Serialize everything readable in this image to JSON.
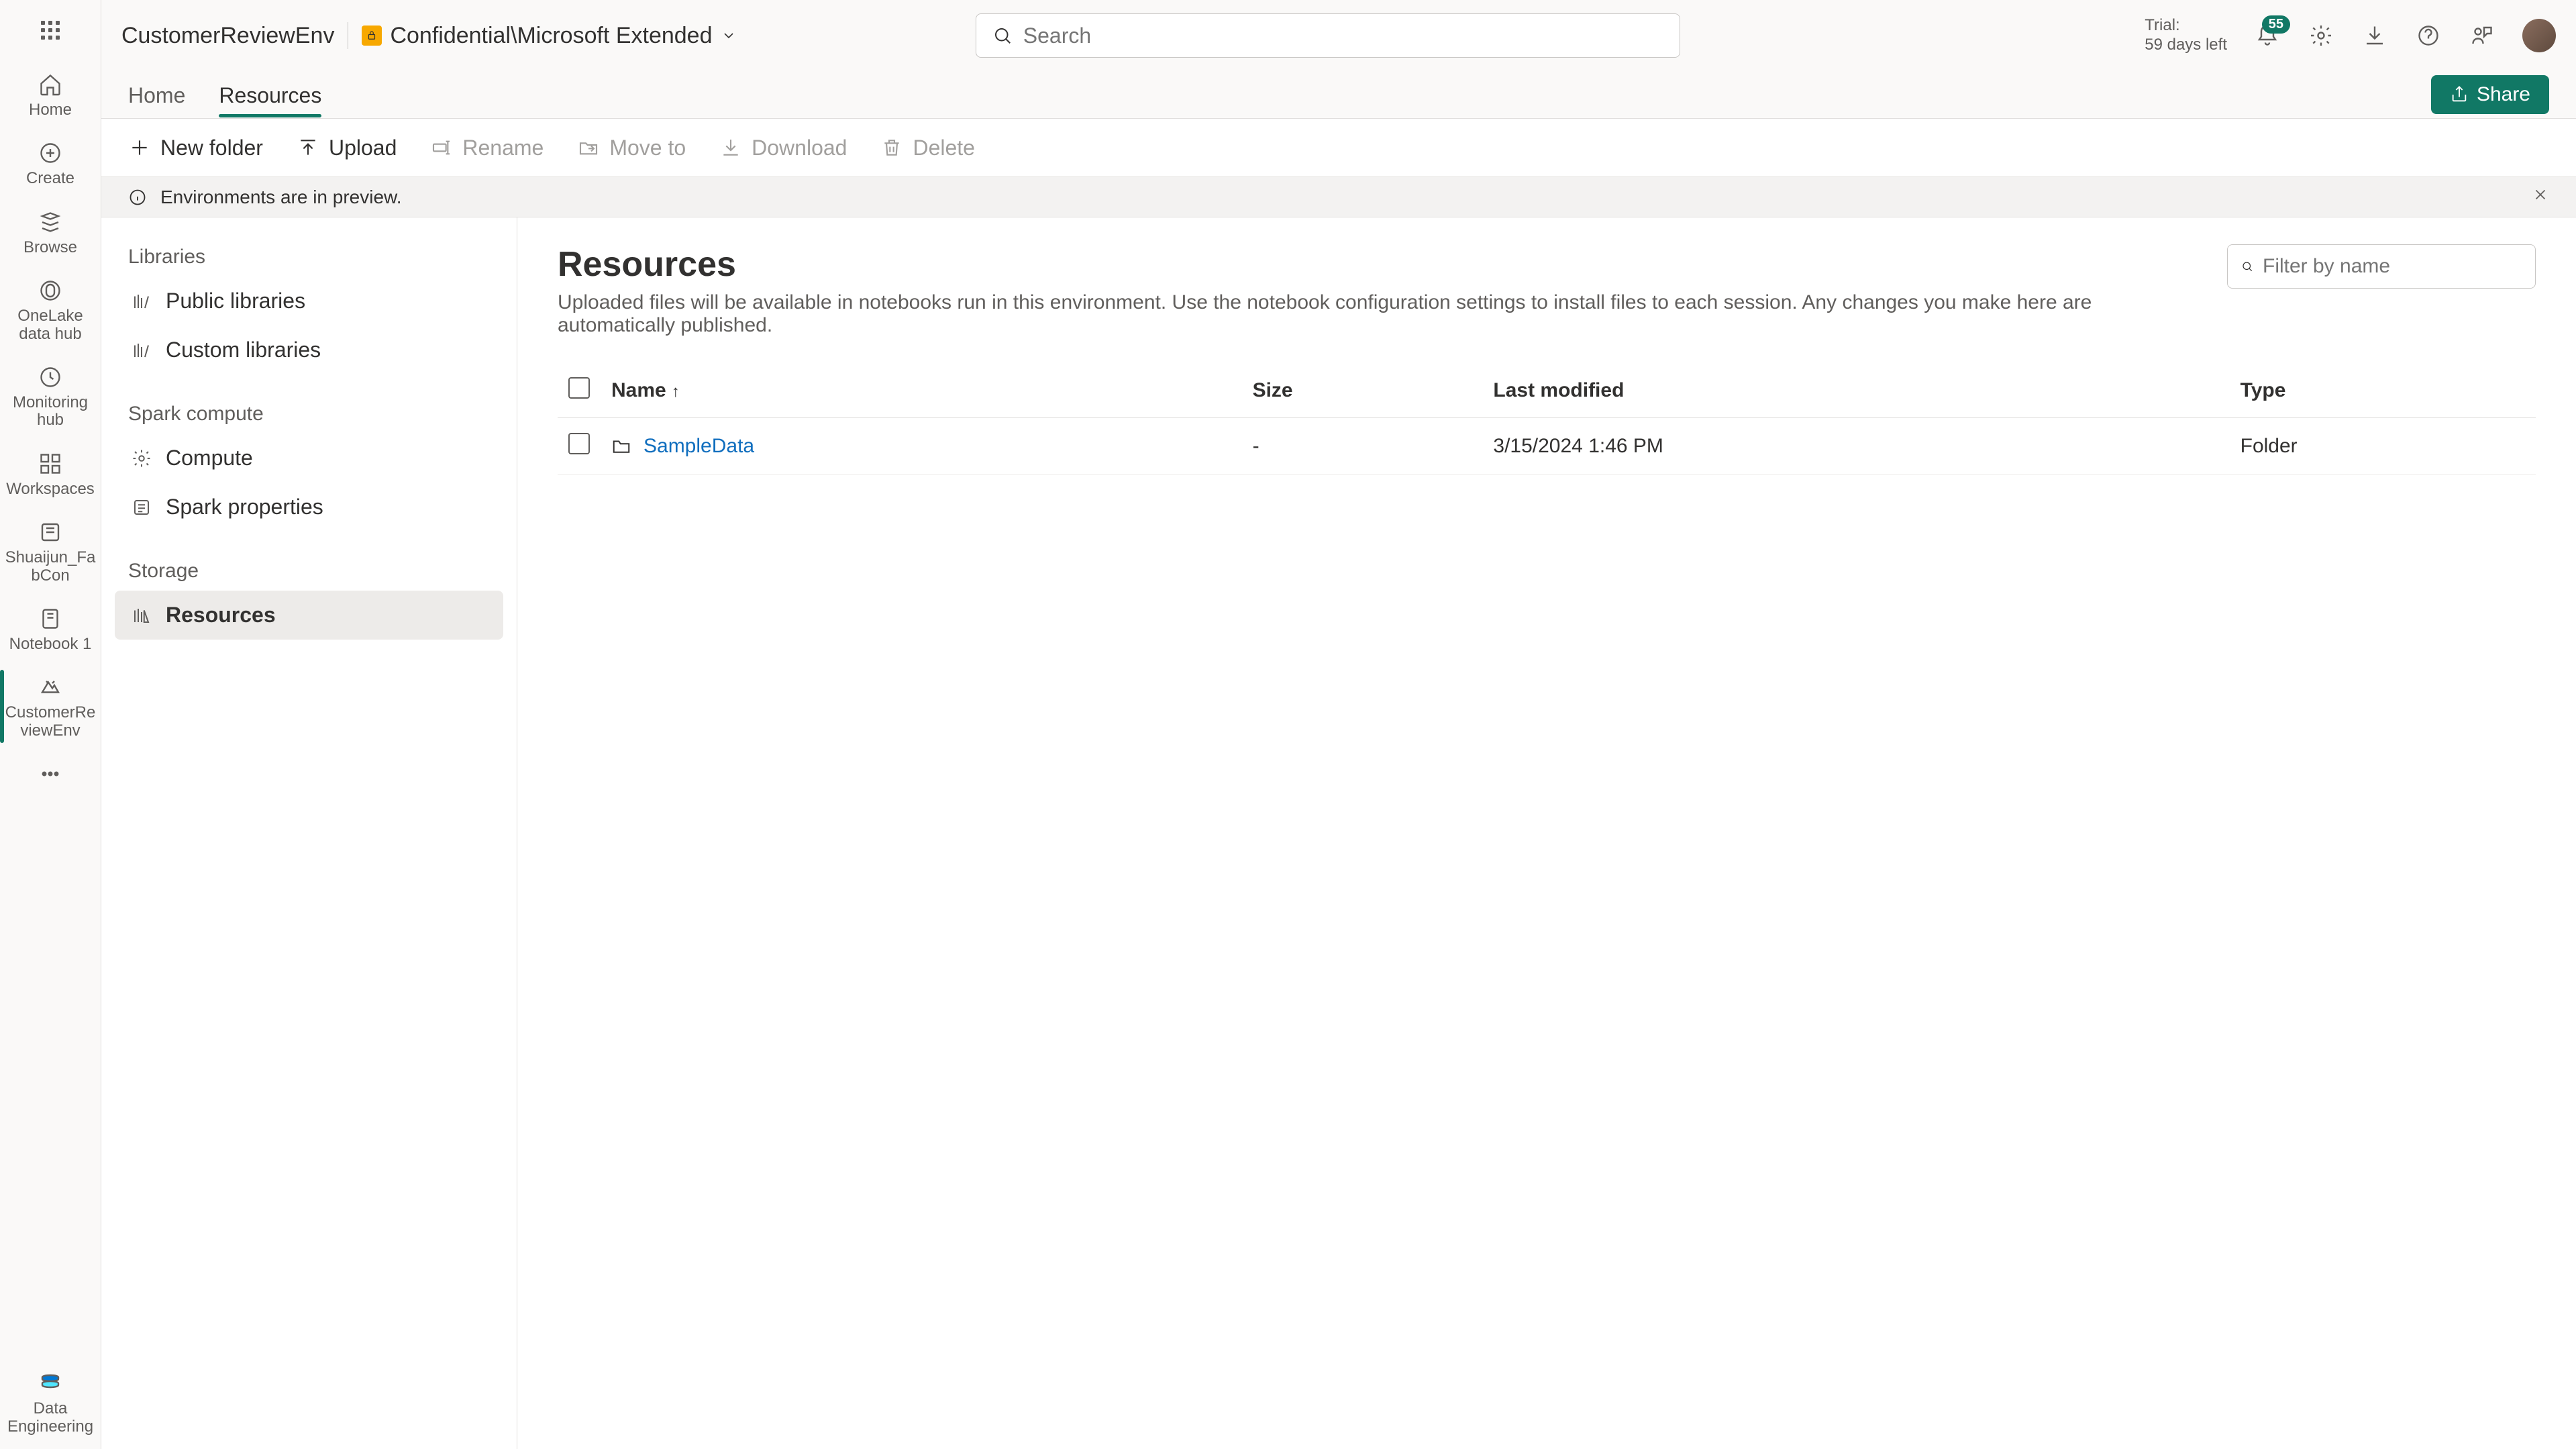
{
  "topbar": {
    "env_name": "CustomerReviewEnv",
    "sensitivity_label": "Confidential\\Microsoft Extended",
    "search_placeholder": "Search",
    "trial_label": "Trial:",
    "trial_remaining": "59 days left",
    "notification_count": "55"
  },
  "tabs": {
    "home": "Home",
    "resources": "Resources",
    "share": "Share"
  },
  "toolbar": {
    "new_folder": "New folder",
    "upload": "Upload",
    "rename": "Rename",
    "move_to": "Move to",
    "download": "Download",
    "delete": "Delete"
  },
  "banner": {
    "text": "Environments are in preview."
  },
  "sidebar": {
    "sections": {
      "libraries_title": "Libraries",
      "public_libraries": "Public libraries",
      "custom_libraries": "Custom libraries",
      "spark_title": "Spark compute",
      "compute": "Compute",
      "spark_properties": "Spark properties",
      "storage_title": "Storage",
      "resources": "Resources"
    }
  },
  "left_rail": {
    "home": "Home",
    "create": "Create",
    "browse": "Browse",
    "onelake": "OneLake data hub",
    "monitoring": "Monitoring hub",
    "workspaces": "Workspaces",
    "shuaijun": "Shuaijun_FabCon",
    "notebook1": "Notebook 1",
    "customer_env": "CustomerReviewEnv",
    "data_eng": "Data Engineering"
  },
  "pane": {
    "title": "Resources",
    "description": "Uploaded files will be available in notebooks run in this environment. Use the notebook configuration settings to install files to each session. Any changes you make here are automatically published.",
    "filter_placeholder": "Filter by name"
  },
  "table": {
    "cols": {
      "name": "Name",
      "size": "Size",
      "modified": "Last modified",
      "type": "Type"
    },
    "rows": [
      {
        "name": "SampleData",
        "size": "-",
        "modified": "3/15/2024 1:46 PM",
        "type": "Folder"
      }
    ]
  }
}
